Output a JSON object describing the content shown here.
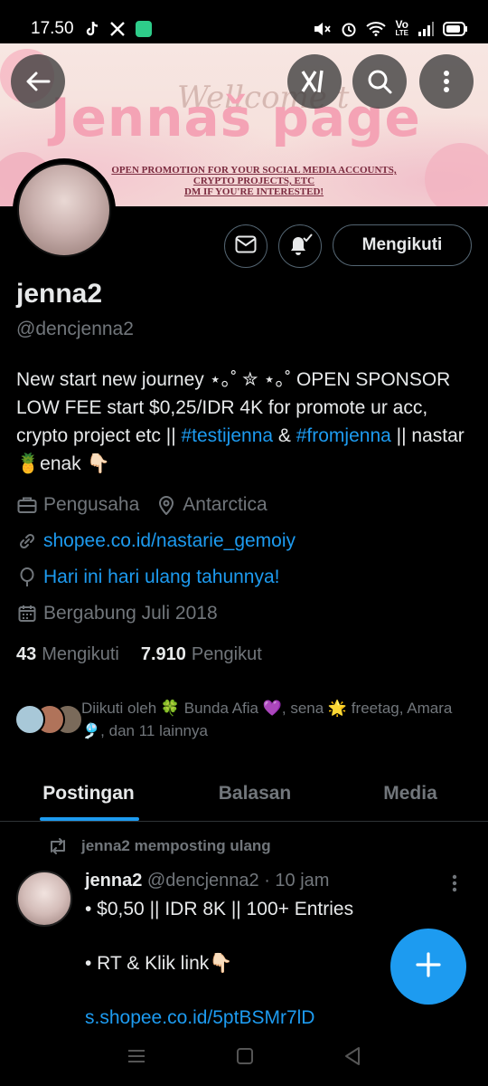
{
  "status_bar": {
    "time": "17.50",
    "app_icons": [
      "tiktok-icon",
      "x-icon",
      "app-icon"
    ],
    "right_icons": [
      "mute-icon",
      "alarm-icon",
      "wifi-icon",
      "volte-icon",
      "signal-icon",
      "battery-icon"
    ],
    "volte_top": "Vo",
    "volte_bottom": "LTE"
  },
  "banner": {
    "welcome_text": "Wellcome t",
    "title": "Jennaš page",
    "promo_lines": [
      "OPEN PROMOTION FOR YOUR SOCIAL MEDIA ACCOUNTS,",
      "CRYPTO PROJECTS, ETC",
      "DM IF YOU'RE INTERESTED!"
    ]
  },
  "top_nav": {
    "back": "back-icon",
    "grok": "grok-icon",
    "search": "search-icon",
    "more": "more-icon"
  },
  "profile": {
    "follow_button": "Mengikuti",
    "display_name": "jenna2",
    "handle": "@dencjenna2",
    "bio_part1": "New start new journey ⋆｡˚ ✮ ⋆｡˚ OPEN SPONSOR LOW FEE start $0,25/IDR 4K for promote ur acc, crypto project etc || ",
    "bio_link1": "#testijenna",
    "bio_part2": " & ",
    "bio_link2": "#fromjenna",
    "bio_part3": " || nastar 🍍enak 👇🏻",
    "profession": "Pengusaha",
    "location": "Antarctica",
    "website": "shopee.co.id/nastarie_gemoiy",
    "birthday": "Hari ini hari ulang tahunnya!",
    "joined": "Bergabung Juli 2018",
    "following_count": "43",
    "following_label": "Mengikuti",
    "followers_count": "7.910",
    "followers_label": "Pengikut",
    "followed_by": "Diikuti oleh 🍀 Bunda Afia 💜, sena 🌟 freetag, Amara🎐, dan 11 lainnya"
  },
  "tabs": [
    {
      "label": "Postingan",
      "active": true
    },
    {
      "label": "Balasan",
      "active": false
    },
    {
      "label": "Media",
      "active": false
    }
  ],
  "tweet": {
    "repost_label": "jenna2 memposting ulang",
    "author_name": "jenna2",
    "author_handle_time": "@dencjenna2 · 10 jam",
    "lines": [
      "• $0,50 || IDR 8K || 100+ Entries",
      "",
      "• RT & Klik link👇🏻",
      "",
      "s.shopee.co.id/5ptBSMr7lD"
    ]
  },
  "colors": {
    "accent": "#1d9bf0",
    "muted": "#71767b",
    "text": "#e7e9ea",
    "background": "#000000"
  }
}
